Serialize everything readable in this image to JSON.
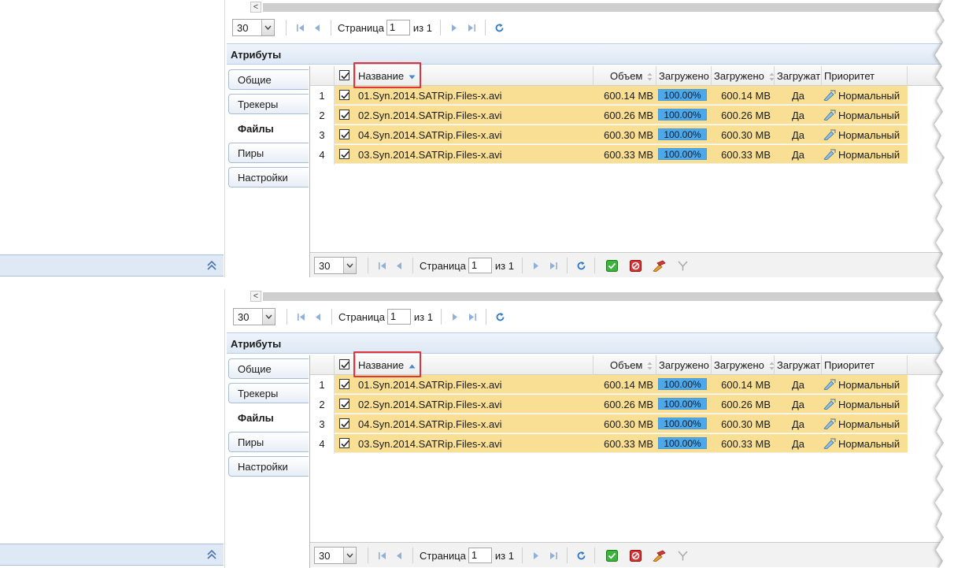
{
  "panels": [
    {
      "id": "a",
      "top_pager": {
        "page_size": "30",
        "page_label": "Страница",
        "page_value": "1",
        "of_label": "из 1"
      },
      "section_title": "Атрибуты",
      "tabs": [
        {
          "label": "Общие",
          "active": false
        },
        {
          "label": "Трекеры",
          "active": false
        },
        {
          "label": "Файлы",
          "active": true
        },
        {
          "label": "Пиры",
          "active": false
        },
        {
          "label": "Настройки",
          "active": false
        }
      ],
      "columns": {
        "name": "Название",
        "size": "Объем",
        "progress": "Загружено",
        "downloaded": "Загружено",
        "download": "Загружат",
        "priority": "Приоритет"
      },
      "sort_direction": "down",
      "rows": [
        {
          "num": "1",
          "name": "01.Syn.2014.SATRip.Files-x.avi",
          "size": "600.14 MB",
          "progress": "100.00%",
          "downloaded": "600.14 MB",
          "download": "Да",
          "priority": "Нормальный"
        },
        {
          "num": "2",
          "name": "02.Syn.2014.SATRip.Files-x.avi",
          "size": "600.26 MB",
          "progress": "100.00%",
          "downloaded": "600.26 MB",
          "download": "Да",
          "priority": "Нормальный"
        },
        {
          "num": "3",
          "name": "04.Syn.2014.SATRip.Files-x.avi",
          "size": "600.30 MB",
          "progress": "100.00%",
          "downloaded": "600.30 MB",
          "download": "Да",
          "priority": "Нормальный"
        },
        {
          "num": "4",
          "name": "03.Syn.2014.SATRip.Files-x.avi",
          "size": "600.33 MB",
          "progress": "100.00%",
          "downloaded": "600.33 MB",
          "download": "Да",
          "priority": "Нормальный"
        }
      ],
      "bottom_pager": {
        "page_size": "30",
        "page_label": "Страница",
        "page_value": "1",
        "of_label": "из 1"
      }
    },
    {
      "id": "b",
      "top_pager": {
        "page_size": "30",
        "page_label": "Страница",
        "page_value": "1",
        "of_label": "из 1"
      },
      "section_title": "Атрибуты",
      "tabs": [
        {
          "label": "Общие",
          "active": false
        },
        {
          "label": "Трекеры",
          "active": false
        },
        {
          "label": "Файлы",
          "active": true
        },
        {
          "label": "Пиры",
          "active": false
        },
        {
          "label": "Настройки",
          "active": false
        }
      ],
      "columns": {
        "name": "Название",
        "size": "Объем",
        "progress": "Загружено",
        "downloaded": "Загружено",
        "download": "Загружат",
        "priority": "Приоритет"
      },
      "sort_direction": "up",
      "rows": [
        {
          "num": "1",
          "name": "01.Syn.2014.SATRip.Files-x.avi",
          "size": "600.14 MB",
          "progress": "100.00%",
          "downloaded": "600.14 MB",
          "download": "Да",
          "priority": "Нормальный"
        },
        {
          "num": "2",
          "name": "02.Syn.2014.SATRip.Files-x.avi",
          "size": "600.26 MB",
          "progress": "100.00%",
          "downloaded": "600.26 MB",
          "download": "Да",
          "priority": "Нормальный"
        },
        {
          "num": "3",
          "name": "04.Syn.2014.SATRip.Files-x.avi",
          "size": "600.30 MB",
          "progress": "100.00%",
          "downloaded": "600.30 MB",
          "download": "Да",
          "priority": "Нормальный"
        },
        {
          "num": "4",
          "name": "03.Syn.2014.SATRip.Files-x.avi",
          "size": "600.33 MB",
          "progress": "100.00%",
          "downloaded": "600.33 MB",
          "download": "Да",
          "priority": "Нормальный"
        }
      ],
      "bottom_pager": {
        "page_size": "30",
        "page_label": "Страница",
        "page_value": "1",
        "of_label": "из 1"
      }
    }
  ],
  "colors": {
    "row_fill": "#f9df94",
    "progress_fill": "#4da8e9",
    "highlight": "#e1333a",
    "header_band": "#dde8f5"
  },
  "icons": {
    "pager": [
      "first-page-icon",
      "prev-page-icon",
      "next-page-icon",
      "last-page-icon",
      "refresh-icon"
    ],
    "bottom_actions": [
      "check-all-icon",
      "uncheck-all-icon",
      "priority-icon",
      "filter-icon"
    ],
    "collapse": "double-chevron-up-icon",
    "scroll_left": "scroll-left-icon"
  }
}
